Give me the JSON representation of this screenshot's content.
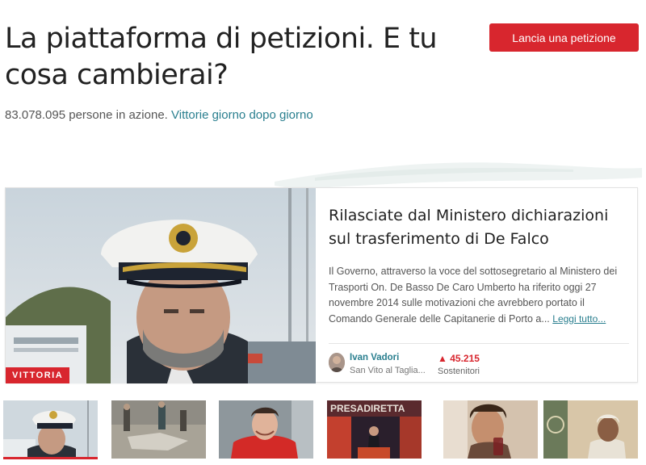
{
  "header": {
    "headline": "La piattaforma di petizioni. E tu cosa cambierai?",
    "start_button": "Lancia una petizione"
  },
  "stats": {
    "count_text": "83.078.095 persone in azione.",
    "link": "Vittorie giorno dopo giorno"
  },
  "featured": {
    "badge": "VITTORIA",
    "title": "Rilasciate dal Ministero dichiarazioni sul trasferimento di De Falco",
    "description": "Il Governo, attraverso la voce del sottosegretario al Ministero dei Trasporti On. De Basso De Caro Umberto ha riferito oggi 27 novembre 2014 sulle motivazioni che avrebbero portato il Comando Generale delle Capitanerie di Porto a...",
    "read_more": "Leggi tutto...",
    "author_name": "Ivan Vadori",
    "author_location": "San Vito al Taglia...",
    "supporters_count": "45.215",
    "supporters_label": "Sostenitori"
  },
  "thumbnails": [
    {
      "name": "thumb-captain",
      "active": true
    },
    {
      "name": "thumb-field-workers",
      "active": false
    },
    {
      "name": "thumb-young-man-red-jacket",
      "active": false
    },
    {
      "name": "thumb-presadiretta",
      "active": false
    },
    {
      "name": "thumb-man-drinking",
      "active": false
    },
    {
      "name": "thumb-video-call-woman",
      "active": false
    }
  ],
  "colors": {
    "brand_red": "#d8262e",
    "link_teal": "#2a7f8f"
  }
}
